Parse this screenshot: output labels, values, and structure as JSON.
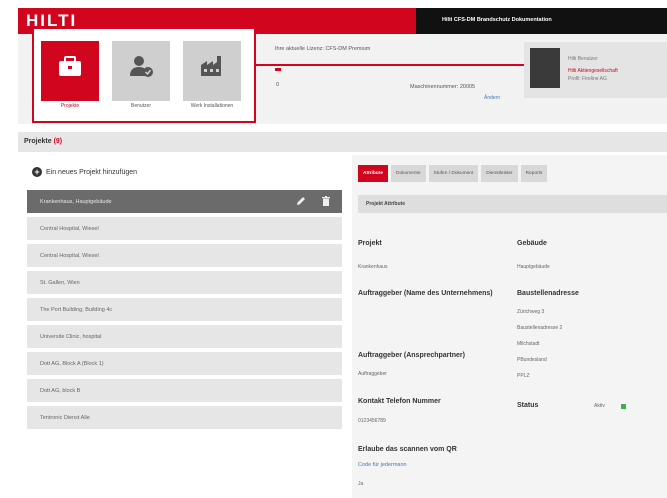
{
  "topbar": {
    "brand": "HILTI",
    "title": "Hilti CFS-DM Brandschutz Dokumentation"
  },
  "tiles": [
    {
      "label": "Projekte",
      "icon": "briefcase-icon",
      "active": true
    },
    {
      "label": "Benutzer",
      "icon": "user-check-icon",
      "active": false
    },
    {
      "label": "Werk Installationen",
      "icon": "factory-icon",
      "active": false
    }
  ],
  "header": {
    "pass_text": "Ihre aktuelle Lizenz:  CFS-DM Premium",
    "count": "0",
    "machine": "Maschinennummer:  20005",
    "change_link": "Ändern",
    "user_name": "Hilti Benutzer",
    "user_red": "Hilti Aktiengesellschaft",
    "user_sub": "Profil: Fireline AG"
  },
  "section": {
    "title": "Projekte",
    "count": "(9)"
  },
  "projects": {
    "add_label": "Ein neues Projekt hinzufügen",
    "items": [
      "Krankenhaus, Hauptgebäude",
      "Central Hospital, Wiesel",
      "Central Hospital, Wiesel",
      "St. Gallen, Wien",
      "The Port Building, Building 4c",
      "Universite Clinic, hospital",
      "Dott AG, Block A (Block 1)",
      "Dott AG, block B",
      "Tentronic Dienst Alle"
    ]
  },
  "tabs": [
    "Attribute",
    "Dokumente",
    "Stufen / Dokument",
    "Dienstleister",
    "Reports"
  ],
  "subbar": "Projekt Attribute",
  "attributes": {
    "projekt_label": "Projekt",
    "projekt_value": "Krankenhaus",
    "gebaeude_label": "Gebäude",
    "gebaeude_value": "Hauptgebäude",
    "auftraggeber_label": "Auftraggeber (Name des Unternehmens)",
    "bauadresse_label": "Baustellenadresse",
    "bauadresse_lines": [
      "Zürichweg 3",
      "Baustellenadresse 2",
      "Milchstadt",
      "PBundesland",
      "PPLZ"
    ],
    "ansprech_label": "Auftraggeber (Ansprechpartner)",
    "ansprech_value": "Auftraggeber",
    "telefon_label": "Kontakt Telefon Nummer",
    "telefon_value": "0123456789",
    "status_label": "Status",
    "status_value": "Aktiv",
    "qr_label": "Erlaube das scannen vom QR",
    "qr_value": "Code für jedermann",
    "qr_answer": "Ja"
  },
  "colors": {
    "brand": "#d2051e",
    "status_ok": "#3db04b"
  }
}
